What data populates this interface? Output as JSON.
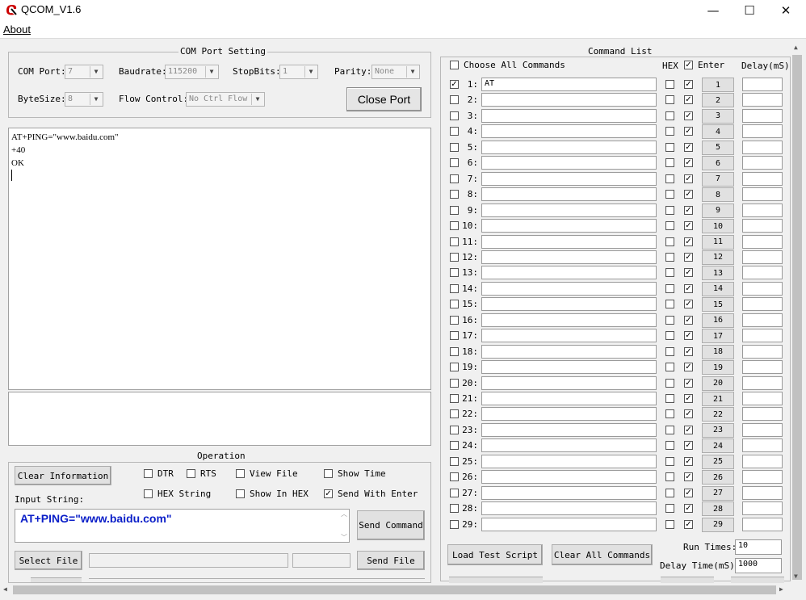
{
  "window": {
    "title": "QCOM_V1.6",
    "minimize": "—",
    "maximize": "☐",
    "close": "✕"
  },
  "menu": {
    "about": "About"
  },
  "com_setting": {
    "title": "COM Port Setting",
    "com_port_label": "COM Port:",
    "com_port_value": "7",
    "baudrate_label": "Baudrate:",
    "baudrate_value": "115200",
    "stopbits_label": "StopBits:",
    "stopbits_value": "1",
    "parity_label": "Parity:",
    "parity_value": "None",
    "bytesize_label": "ByteSize:",
    "bytesize_value": "8",
    "flow_label": "Flow Control:",
    "flow_value": "No Ctrl Flow",
    "close_port": "Close Port"
  },
  "receive": {
    "lines": [
      "AT+PING=\"www.baidu.com\"",
      "+40",
      "",
      "OK"
    ]
  },
  "operation": {
    "title": "Operation",
    "clear_info": "Clear Information",
    "dtr": "DTR",
    "rts": "RTS",
    "view_file": "View File",
    "show_time": "Show Time",
    "hex_string": "HEX String",
    "show_in_hex": "Show In HEX",
    "send_with_enter": "Send With Enter",
    "input_label": "Input String:",
    "input_value": "AT+PING=\"www.baidu.com\"",
    "send_command": "Send Command",
    "select_file": "Select File",
    "send_file": "Send File"
  },
  "command_list": {
    "title": "Command List",
    "choose_all": "Choose All Commands",
    "hex_header": "HEX",
    "enter_header": "Enter",
    "delay_header": "Delay(mS)",
    "rows": [
      {
        "num": "1:",
        "value": "AT",
        "checked": true,
        "btn": "1"
      },
      {
        "num": "2:",
        "value": "",
        "checked": false,
        "btn": "2"
      },
      {
        "num": "3:",
        "value": "",
        "checked": false,
        "btn": "3"
      },
      {
        "num": "4:",
        "value": "",
        "checked": false,
        "btn": "4"
      },
      {
        "num": "5:",
        "value": "",
        "checked": false,
        "btn": "5"
      },
      {
        "num": "6:",
        "value": "",
        "checked": false,
        "btn": "6"
      },
      {
        "num": "7:",
        "value": "",
        "checked": false,
        "btn": "7"
      },
      {
        "num": "8:",
        "value": "",
        "checked": false,
        "btn": "8"
      },
      {
        "num": "9:",
        "value": "",
        "checked": false,
        "btn": "9"
      },
      {
        "num": "10:",
        "value": "",
        "checked": false,
        "btn": "10"
      },
      {
        "num": "11:",
        "value": "",
        "checked": false,
        "btn": "11"
      },
      {
        "num": "12:",
        "value": "",
        "checked": false,
        "btn": "12"
      },
      {
        "num": "13:",
        "value": "",
        "checked": false,
        "btn": "13"
      },
      {
        "num": "14:",
        "value": "",
        "checked": false,
        "btn": "14"
      },
      {
        "num": "15:",
        "value": "",
        "checked": false,
        "btn": "15"
      },
      {
        "num": "16:",
        "value": "",
        "checked": false,
        "btn": "16"
      },
      {
        "num": "17:",
        "value": "",
        "checked": false,
        "btn": "17"
      },
      {
        "num": "18:",
        "value": "",
        "checked": false,
        "btn": "18"
      },
      {
        "num": "19:",
        "value": "",
        "checked": false,
        "btn": "19"
      },
      {
        "num": "20:",
        "value": "",
        "checked": false,
        "btn": "20"
      },
      {
        "num": "21:",
        "value": "",
        "checked": false,
        "btn": "21"
      },
      {
        "num": "22:",
        "value": "",
        "checked": false,
        "btn": "22"
      },
      {
        "num": "23:",
        "value": "",
        "checked": false,
        "btn": "23"
      },
      {
        "num": "24:",
        "value": "",
        "checked": false,
        "btn": "24"
      },
      {
        "num": "25:",
        "value": "",
        "checked": false,
        "btn": "25"
      },
      {
        "num": "26:",
        "value": "",
        "checked": false,
        "btn": "26"
      },
      {
        "num": "27:",
        "value": "",
        "checked": false,
        "btn": "27"
      },
      {
        "num": "28:",
        "value": "",
        "checked": false,
        "btn": "28"
      },
      {
        "num": "29:",
        "value": "",
        "checked": false,
        "btn": "29"
      }
    ],
    "load_script": "Load Test Script",
    "clear_all": "Clear All Commands",
    "run_times_label": "Run Times:",
    "run_times_value": "10",
    "delay_time_label": "Delay Time(mS):",
    "delay_time_value": "1000"
  },
  "colors": {
    "accent_text": "#0a1ec8",
    "window_bg": "#f0f0f0"
  }
}
